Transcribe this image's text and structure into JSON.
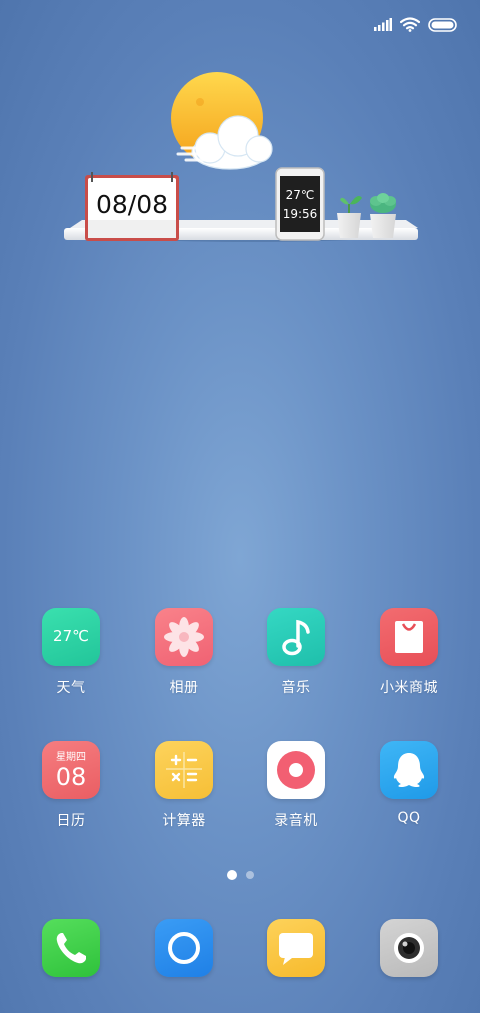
{
  "status_bar": {
    "icons": [
      "signal-icon",
      "wifi-icon",
      "battery-icon"
    ]
  },
  "widget": {
    "calendar_date": "08/08",
    "phone_temp": "27℃",
    "phone_time": "19:56",
    "weather_icon": "sun-cloud-icon"
  },
  "apps": [
    {
      "label": "天气",
      "icon": "weather-icon",
      "icon_text": "27℃",
      "color": "#2fd4a0"
    },
    {
      "label": "相册",
      "icon": "gallery-flower-icon",
      "color": "#f4707d"
    },
    {
      "label": "音乐",
      "icon": "music-note-icon",
      "color": "#29c9b5"
    },
    {
      "label": "小米商城",
      "icon": "shopping-bag-icon",
      "color": "#ef5d62"
    },
    {
      "label": "日历",
      "icon": "calendar-icon",
      "icon_weekday": "星期四",
      "icon_day": "08",
      "color": "#ef6a6e"
    },
    {
      "label": "计算器",
      "icon": "calculator-icon",
      "color": "#f9c94a"
    },
    {
      "label": "录音机",
      "icon": "recorder-icon",
      "color": "#ffffff"
    },
    {
      "label": "QQ",
      "icon": "qq-penguin-icon",
      "color": "#2ea8f0"
    }
  ],
  "page_indicator": {
    "total": 2,
    "current": 1
  },
  "dock": [
    {
      "icon": "phone-icon",
      "color": "#3fd14a"
    },
    {
      "icon": "browser-icon",
      "color": "#2e8ff0"
    },
    {
      "icon": "messages-icon",
      "color": "#fbc73c"
    },
    {
      "icon": "camera-icon",
      "color": "#c8c8c8"
    }
  ]
}
